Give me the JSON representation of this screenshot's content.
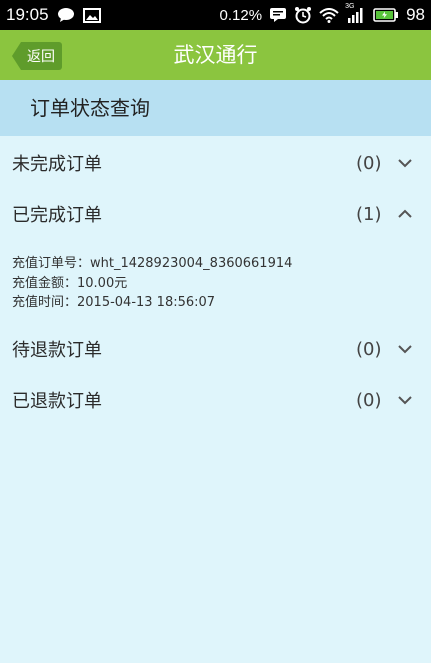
{
  "status_bar": {
    "time": "19:05",
    "data_speed": "0.12%",
    "network_type": "3G",
    "battery": "98",
    "icons": [
      "chat-icon",
      "image-icon",
      "message-icon",
      "alarm-icon",
      "wifi-icon",
      "signal-icon",
      "battery-icon"
    ]
  },
  "nav": {
    "back_label": "返回",
    "title": "武汉通行"
  },
  "section_title": "订单状态查询",
  "orders": [
    {
      "label": "未完成订单",
      "count": "(0)",
      "expanded": false
    },
    {
      "label": "已完成订单",
      "count": "(1)",
      "expanded": true
    },
    {
      "label": "待退款订单",
      "count": "(0)",
      "expanded": false
    },
    {
      "label": "已退款订单",
      "count": "(0)",
      "expanded": false
    }
  ],
  "completed_detail": {
    "order_no": "充值订单号：wht_1428923004_8360661914",
    "amount": "充值金额：10.00元",
    "time": "充值时间：2015-04-13 18:56:07"
  },
  "colors": {
    "nav_bg": "#8bc53f",
    "back_button": "#5f9c2b",
    "section_bg": "#b7e0f2",
    "page_bg": "#dff5fb"
  }
}
